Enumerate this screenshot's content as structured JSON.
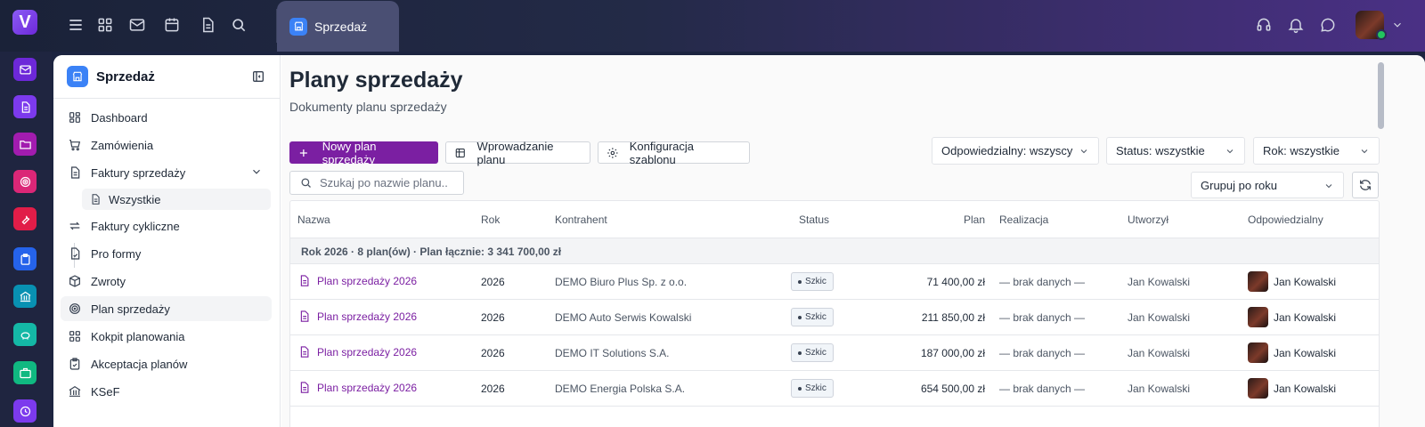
{
  "topbar": {
    "logo_letter": "V",
    "app_tab_label": "Sprzedaż",
    "icons": [
      "menu-icon",
      "apps-grid-icon",
      "mail-icon",
      "calendar-icon",
      "document-icon",
      "search-icon",
      "headset-icon",
      "bell-icon",
      "chat-icon",
      "chevron-down-icon"
    ]
  },
  "rail": {
    "items": [
      {
        "icon": "mail-icon",
        "color": "#6d28d9"
      },
      {
        "icon": "document-icon",
        "color": "#7c3aed"
      },
      {
        "icon": "folder-icon",
        "color": "#a21caf"
      },
      {
        "icon": "target-icon",
        "color": "#db2777"
      },
      {
        "icon": "wrench-icon",
        "color": "#e11d48"
      },
      {
        "icon": "clipboard-icon",
        "color": "#2563eb"
      },
      {
        "icon": "bank-icon",
        "color": "#0891b2"
      },
      {
        "icon": "piggy-bank-icon",
        "color": "#14b8a6"
      },
      {
        "icon": "briefcase-icon",
        "color": "#10b981"
      },
      {
        "icon": "clock-icon",
        "color": "#7c3aed"
      }
    ]
  },
  "sidebar": {
    "title": "Sprzedaż",
    "items": [
      {
        "label": "Dashboard"
      },
      {
        "label": "Zamówienia"
      },
      {
        "label": "Faktury sprzedaży"
      },
      {
        "label": "Wszystkie"
      },
      {
        "label": "Faktury cykliczne"
      },
      {
        "label": "Pro formy"
      },
      {
        "label": "Zwroty"
      },
      {
        "label": "Plan sprzedaży"
      },
      {
        "label": "Kokpit planowania"
      },
      {
        "label": "Akceptacja planów"
      },
      {
        "label": "KSeF"
      }
    ]
  },
  "main": {
    "title": "Plany sprzedaży",
    "subtitle": "Dokumenty planu sprzedaży",
    "buttons": {
      "new_plan": "Nowy plan sprzedaży",
      "enter_plan": "Wprowadzanie planu",
      "template_config": "Konfiguracja szablonu"
    },
    "filters": {
      "responsible": "Odpowiedzialny: wszyscy",
      "status": "Status: wszystkie",
      "year": "Rok: wszystkie",
      "group": "Grupuj po roku"
    },
    "search": {
      "placeholder": "Szukaj po nazwie planu.."
    },
    "table": {
      "headers": {
        "name": "Nazwa",
        "year": "Rok",
        "contractor": "Kontrahent",
        "status": "Status",
        "plan": "Plan",
        "realization": "Realizacja",
        "created_by": "Utworzył",
        "responsible": "Odpowiedzialny"
      },
      "group_label": "Rok 2026 · 8 plan(ów) · Plan łącznie: 3 341 700,00 zł",
      "rows": [
        {
          "name": "Plan sprzedaży 2026",
          "year": "2026",
          "contractor": "DEMO Biuro Plus Sp. z o.o.",
          "status": "Szkic",
          "plan": "71 400,00 zł",
          "realization": "— brak danych —",
          "created_by": "Jan Kowalski",
          "responsible": "Jan Kowalski"
        },
        {
          "name": "Plan sprzedaży 2026",
          "year": "2026",
          "contractor": "DEMO Auto Serwis Kowalski",
          "status": "Szkic",
          "plan": "211 850,00 zł",
          "realization": "— brak danych —",
          "created_by": "Jan Kowalski",
          "responsible": "Jan Kowalski"
        },
        {
          "name": "Plan sprzedaży 2026",
          "year": "2026",
          "contractor": "DEMO IT Solutions S.A.",
          "status": "Szkic",
          "plan": "187 000,00 zł",
          "realization": "— brak danych —",
          "created_by": "Jan Kowalski",
          "responsible": "Jan Kowalski"
        },
        {
          "name": "Plan sprzedaży 2026",
          "year": "2026",
          "contractor": "DEMO Energia Polska S.A.",
          "status": "Szkic",
          "plan": "654 500,00 zł",
          "realization": "— brak danych —",
          "created_by": "Jan Kowalski",
          "responsible": "Jan Kowalski"
        }
      ]
    }
  }
}
